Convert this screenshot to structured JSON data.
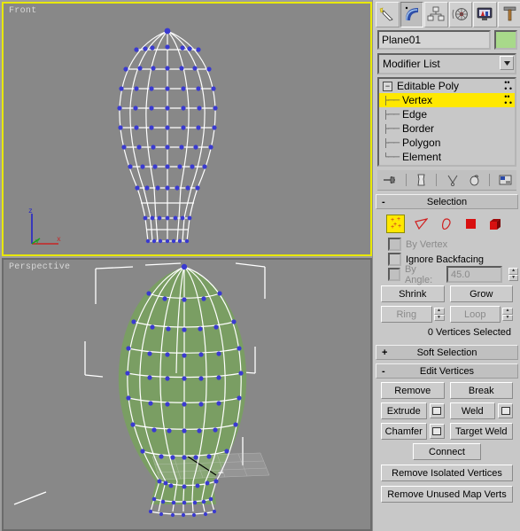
{
  "viewports": [
    {
      "name": "front",
      "label": "Front",
      "active": true,
      "axis": {
        "z": "z",
        "x": "x",
        "y": "y"
      }
    },
    {
      "name": "perspective",
      "label": "Perspective",
      "active": false
    }
  ],
  "command_panel": {
    "tabs": [
      {
        "name": "create",
        "icon": "create-star-icon",
        "selected": false
      },
      {
        "name": "modify",
        "icon": "modify-arc-icon",
        "selected": true
      },
      {
        "name": "hierarchy",
        "icon": "hierarchy-tree-icon",
        "selected": false
      },
      {
        "name": "motion",
        "icon": "motion-wheel-icon",
        "selected": false
      },
      {
        "name": "display",
        "icon": "display-monitor-icon",
        "selected": false
      },
      {
        "name": "utilities",
        "icon": "utilities-hammer-icon",
        "selected": false
      }
    ],
    "object_name": "Plane01",
    "object_color": "#a8d98a",
    "modifier_list_label": "Modifier List",
    "stack": [
      {
        "label": "Editable Poly",
        "level": 0,
        "expanded": true,
        "highlighted": false
      },
      {
        "label": "Vertex",
        "level": 1,
        "highlighted": true
      },
      {
        "label": "Edge",
        "level": 1,
        "highlighted": false
      },
      {
        "label": "Border",
        "level": 1,
        "highlighted": false
      },
      {
        "label": "Polygon",
        "level": 1,
        "highlighted": false
      },
      {
        "label": "Element",
        "level": 1,
        "highlighted": false
      }
    ],
    "stack_tools": [
      {
        "name": "pin-stack-icon"
      },
      {
        "name": "show-end-result-icon"
      },
      {
        "name": "make-unique-icon"
      },
      {
        "name": "remove-modifier-icon"
      },
      {
        "name": "configure-modifier-sets-icon"
      }
    ]
  },
  "selection_rollout": {
    "title": "Selection",
    "expanded": true,
    "sub_object_icons": [
      {
        "name": "vertex",
        "active": true
      },
      {
        "name": "edge",
        "active": false
      },
      {
        "name": "border",
        "active": false
      },
      {
        "name": "polygon",
        "active": false
      },
      {
        "name": "element",
        "active": false
      }
    ],
    "by_vertex": {
      "label": "By Vertex",
      "checked": false,
      "enabled": false
    },
    "ignore_backfacing": {
      "label": "Ignore Backfacing",
      "checked": false,
      "enabled": true
    },
    "by_angle": {
      "label": "By Angle:",
      "value": "45.0",
      "checked": false,
      "enabled": false
    },
    "shrink_label": "Shrink",
    "grow_label": "Grow",
    "ring_label": "Ring",
    "loop_label": "Loop",
    "status": "0 Vertices Selected"
  },
  "soft_selection_rollout": {
    "title": "Soft Selection",
    "expanded": false
  },
  "edit_vertices_rollout": {
    "title": "Edit Vertices",
    "expanded": true,
    "remove_label": "Remove",
    "break_label": "Break",
    "extrude_label": "Extrude",
    "weld_label": "Weld",
    "chamfer_label": "Chamfer",
    "target_weld_label": "Target Weld",
    "connect_label": "Connect",
    "remove_isolated_label": "Remove Isolated Vertices",
    "remove_unused_label": "Remove Unused Map Verts"
  },
  "colors": {
    "viewport_bg": "#888888",
    "active_border": "#e8e800",
    "wireframe": "#ffffff",
    "vertex": "#3a3ad0",
    "shaded_mesh": "#7a9e63",
    "panel_bg": "#c8c8c8"
  }
}
